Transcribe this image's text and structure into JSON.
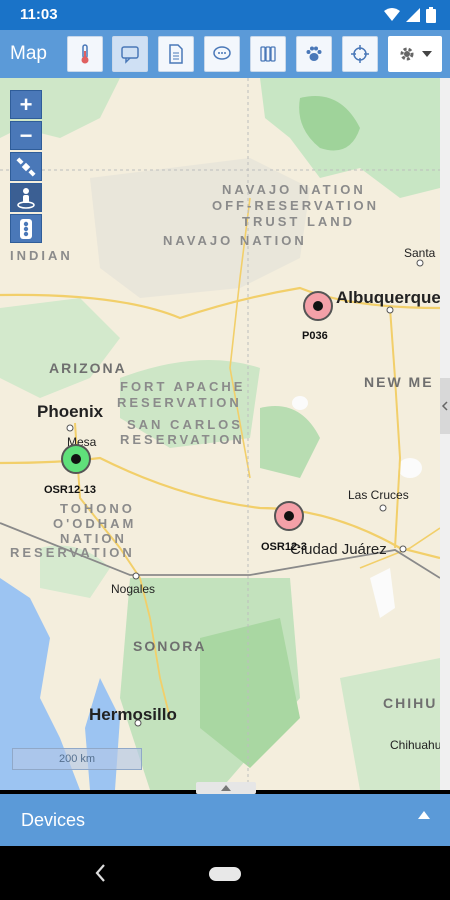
{
  "status": {
    "time": "11:03"
  },
  "toolbar": {
    "title": "Map",
    "buttons": [
      "thermometer-icon",
      "chat-icon",
      "document-icon",
      "message-icon",
      "columns-icon",
      "paw-icon",
      "crosshair-icon"
    ],
    "settings_icon": "gear-icon"
  },
  "map": {
    "zoom_in": "+",
    "zoom_out": "−",
    "places": {
      "albuquerque": "Albuquerque",
      "phoenix": "Phoenix",
      "mesa": "Mesa",
      "las_cruces": "Las Cruces",
      "ciudad_juarez": "Ciudad Juárez",
      "nogales": "Nogales",
      "hermosillo": "Hermosillo",
      "santa": "Santa",
      "chihuahua": "Chihuahua"
    },
    "regions": {
      "navajo_off_1": "NAVAJO NATION",
      "navajo_off_2": "OFF-RESERVATION",
      "navajo_off_3": "TRUST LAND",
      "navajo": "NAVAJO NATION",
      "indian": "INDIAN",
      "fort_apache_1": "FORT APACHE",
      "fort_apache_2": "RESERVATION",
      "san_carlos_1": "SAN CARLOS",
      "san_carlos_2": "RESERVATION",
      "tohono_1": "TOHONO",
      "tohono_2": "O'ODHAM",
      "tohono_3": "NATION",
      "tohono_4": "RESERVATION"
    },
    "states": {
      "arizona": "ARIZONA",
      "new_mexico": "NEW ME",
      "sonora": "SONORA",
      "chihuahua": "CHIHU"
    },
    "markers": [
      {
        "label": "P036",
        "color": "#f4a0a8"
      },
      {
        "label": "OSR12-13",
        "color": "#5fe07a"
      },
      {
        "label": "OSR12-3",
        "color": "#f4a0a8"
      }
    ],
    "scale": "200 km"
  },
  "devices": {
    "label": "Devices"
  },
  "colors": {
    "accent": "#5b9ad8",
    "statusbar": "#1a73c8"
  }
}
